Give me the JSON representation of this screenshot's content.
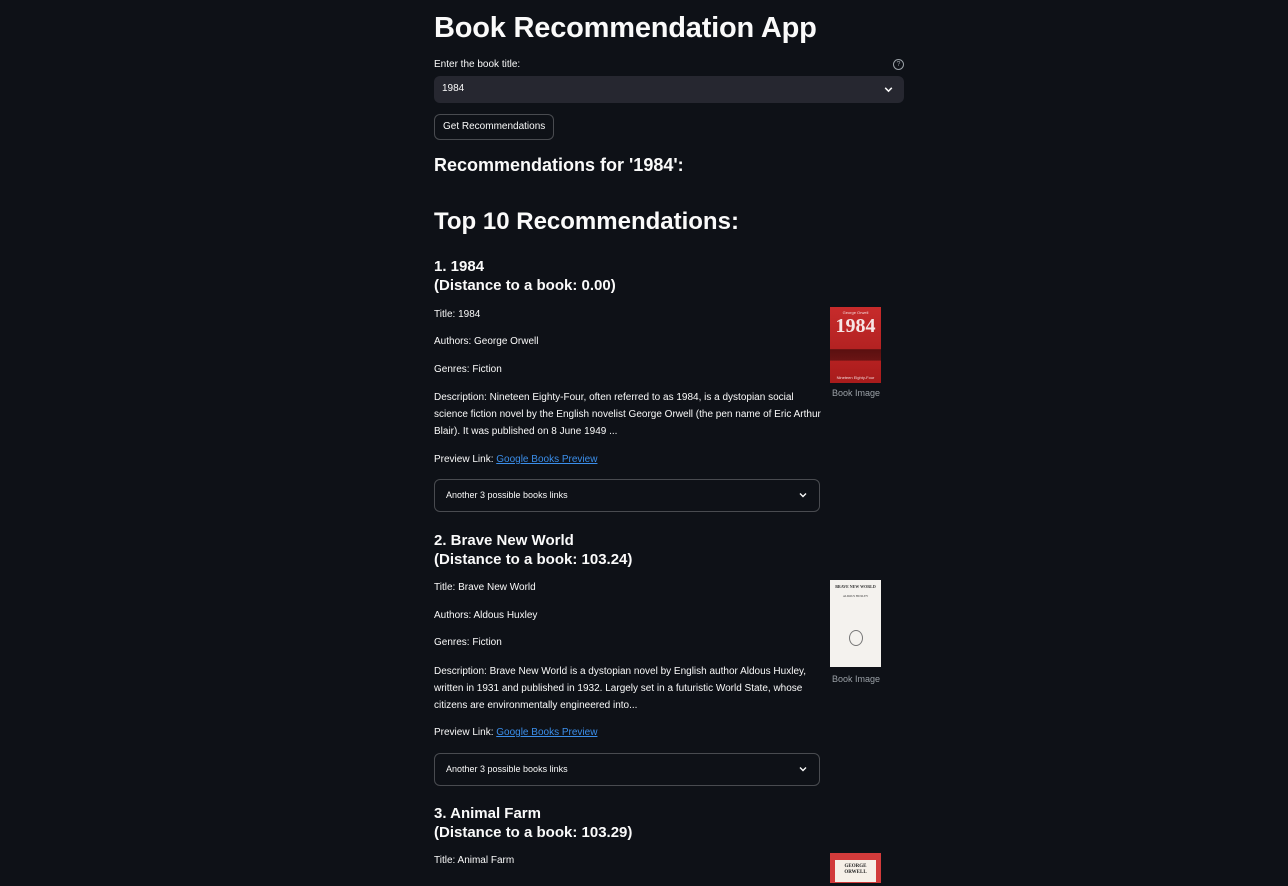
{
  "app": {
    "title": "Book Recommendation App"
  },
  "input": {
    "label": "Enter the book title:",
    "selected_value": "1984",
    "help_icon": "question-circle-icon",
    "chevron_icon": "chevron-down-icon"
  },
  "button": {
    "label": "Get Recommendations"
  },
  "results": {
    "recommendations_for": "Recommendations for '1984':",
    "top_heading": "Top 10 Recommendations:"
  },
  "books": [
    {
      "heading_line1": "1. 1984",
      "heading_line2": "(Distance to a book: 0.00)",
      "title": "Title: 1984",
      "authors": "Authors: George Orwell",
      "genres": "Genres: Fiction",
      "description": "Description: Nineteen Eighty-Four, often referred to as 1984, is a dystopian social science fiction novel by the English novelist George Orwell (the pen name of Eric Arthur Blair). It was published on 8 June 1949 ...",
      "preview_label": "Preview Link: ",
      "preview_link_text": "Google Books Preview",
      "expander_label": "Another 3 possible books links",
      "image_caption": "Book Image",
      "cover_top_text": "George Orwell",
      "cover_big_text": "1984",
      "cover_bottom_text": "Nineteen Eighty-Four"
    },
    {
      "heading_line1": "2. Brave New World",
      "heading_line2": "(Distance to a book: 103.24)",
      "title": "Title: Brave New World",
      "authors": "Authors: Aldous Huxley",
      "genres": "Genres: Fiction",
      "description": "Description: Brave New World is a dystopian novel by English author Aldous Huxley, written in 1931 and published in 1932. Largely set in a futuristic World State, whose citizens are environmentally engineered into...",
      "preview_label": "Preview Link: ",
      "preview_link_text": "Google Books Preview",
      "expander_label": "Another 3 possible books links",
      "image_caption": "Book Image",
      "cover_title_text": "BRAVE NEW WORLD",
      "cover_author_text": "ALDOUS HUXLEY"
    },
    {
      "heading_line1": "3. Animal Farm",
      "heading_line2": "(Distance to a book: 103.29)",
      "title": "Title: Animal Farm",
      "cover_line1": "GEORGE",
      "cover_line2": "ORWELL"
    }
  ]
}
